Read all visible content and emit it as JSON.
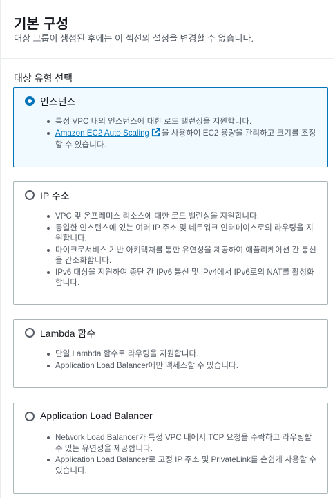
{
  "header": {
    "title": "기본 구성",
    "description": "대상 그룹이 생성된 후에는 이 섹션의 설정을 변경할 수 없습니다."
  },
  "target_type": {
    "label": "대상 유형 선택",
    "options": [
      {
        "title": "인스턴스",
        "selected": true,
        "bullets": [
          "특정 VPC 내의 인스턴스에 대한 로드 밸런싱을 지원합니다.",
          "을 사용하여 EC2 용량을 관리하고 크기를 조정할 수 있습니다."
        ],
        "link_text": "Amazon EC2 Auto Scaling"
      },
      {
        "title": "IP 주소",
        "selected": false,
        "bullets": [
          "VPC 및 온프레미스 리소스에 대한 로드 밸런싱을 지원합니다.",
          "동일한 인스턴스에 있는 여러 IP 주소 및 네트워크 인터페이스로의 라우팅을 지원합니다.",
          "마이크로서비스 기반 아키텍처를 통한 유연성을 제공하여 애플리케이션 간 통신을 간소화합니다.",
          "IPv6 대상을 지원하여 종단 간 IPv6 통신 및 IPv4에서 IPv6로의 NAT를 활성화합니다."
        ]
      },
      {
        "title": "Lambda 함수",
        "selected": false,
        "bullets": [
          "단일 Lambda 함수로 라우팅을 지원합니다.",
          "Application Load Balancer에만 액세스할 수 있습니다."
        ]
      },
      {
        "title": "Application Load Balancer",
        "selected": false,
        "bullets": [
          "Network Load Balancer가 특정 VPC 내에서 TCP 요청을 수락하고 라우팅할 수 있는 유연성을 제공합니다.",
          "Application Load Balancer로 고정 IP 주소 및 PrivateLink를 손쉽게 사용할 수 있습니다."
        ]
      }
    ]
  },
  "colors": {
    "accent": "#0073bb",
    "selected_bg": "#f1faff",
    "border": "#aab7b8",
    "text_secondary": "#545b64"
  }
}
